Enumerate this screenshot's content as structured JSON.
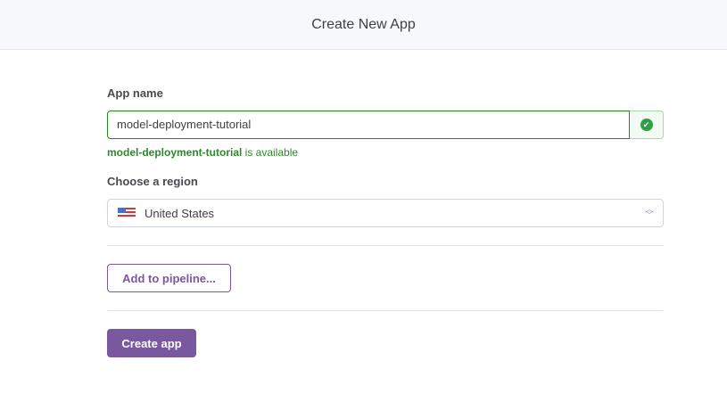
{
  "header": {
    "title": "Create New App"
  },
  "form": {
    "app_name_label": "App name",
    "app_name_value": "model-deployment-tutorial",
    "availability_name": "model-deployment-tutorial",
    "availability_suffix": " is available",
    "region_label": "Choose a region",
    "region_value": "United States",
    "pipeline_button": "Add to pipeline...",
    "create_button": "Create app"
  },
  "colors": {
    "accent": "#79589f",
    "success": "#2b8a2b"
  }
}
